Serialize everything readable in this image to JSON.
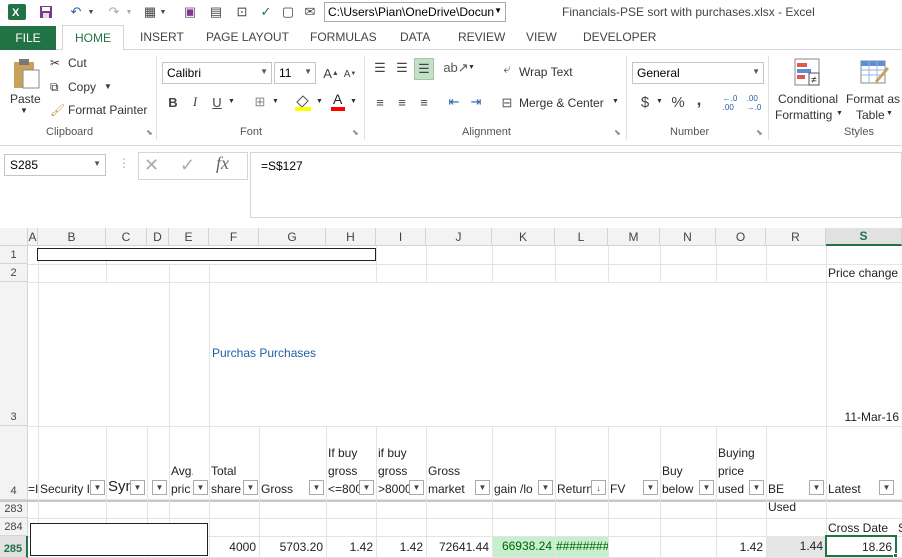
{
  "window": {
    "path": "C:\\Users\\Pian\\OneDrive\\Docun",
    "title": "Financials-PSE sort with purchases.xlsx - Excel"
  },
  "tabs": [
    "FILE",
    "HOME",
    "INSERT",
    "PAGE LAYOUT",
    "FORMULAS",
    "DATA",
    "REVIEW",
    "VIEW",
    "DEVELOPER"
  ],
  "ribbon": {
    "clipboard": {
      "paste": "Paste",
      "cut": "Cut",
      "copy": "Copy",
      "format_painter": "Format Painter",
      "label": "Clipboard"
    },
    "font": {
      "name": "Calibri",
      "size": "11",
      "bold": "B",
      "italic": "I",
      "underline": "U",
      "label": "Font"
    },
    "alignment": {
      "wrap": "Wrap Text",
      "merge": "Merge & Center",
      "label": "Alignment"
    },
    "number": {
      "format": "General",
      "currency": "$",
      "percent": "%",
      "comma": ",",
      "label": "Number"
    },
    "styles": {
      "conditional_1": "Conditional",
      "conditional_2": "Formatting",
      "format_as_1": "Format as",
      "format_as_2": "Table",
      "label": "Styles"
    }
  },
  "formula_bar": {
    "name_box": "S285",
    "formula": "=S$127",
    "fx": "fx"
  },
  "columns": [
    "A",
    "B",
    "C",
    "D",
    "E",
    "F",
    "G",
    "H",
    "I",
    "J",
    "K",
    "L",
    "M",
    "N",
    "O",
    "R",
    "S"
  ],
  "rows": [
    "1",
    "2",
    "3",
    "4",
    "283",
    "284",
    "285"
  ],
  "cells": {
    "s2": "Price change",
    "purchases": "Purchas Purchases",
    "s3": "11-Mar-16",
    "cross_date": "Cross Date",
    "s284_extra": "S"
  },
  "headers": {
    "a4": "=I",
    "b4": "Security I",
    "c4": "Syn",
    "e4": "Avg.\npric",
    "f4": "Total\nshare",
    "g4": "Gross",
    "h4": "If buy\ngross\n<=800",
    "i4": "if buy\ngross\n>8000",
    "j4": "Gross\nmarket",
    "k4": "gain  /lo",
    "l4": "Return",
    "m4": "FV",
    "n4": "Buy\nbelow",
    "o4": "Buying\nprice\nused",
    "r4": "BE Used",
    "s4": "Latest"
  },
  "row285": {
    "f": "4000",
    "g": "5703.20",
    "h": "1.42",
    "i": "1.42",
    "j": "72641.44",
    "k": "66938.24",
    "l": "########",
    "o": "1.42",
    "r": "1.44",
    "s": "18.26"
  },
  "colors": {
    "excel_green": "#217346",
    "gain_fill": "#c6efce",
    "gain_text": "#006100",
    "select_border": "#217346",
    "purchases_text": "#1f5fa8"
  }
}
